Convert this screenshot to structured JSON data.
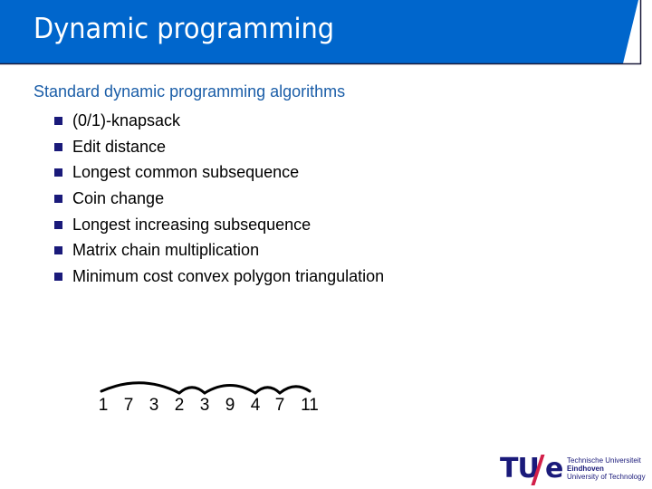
{
  "slide": {
    "title": "Dynamic programming",
    "subtitle": "Standard dynamic programming algorithms",
    "bullets": [
      "(0/1)-knapsack",
      "Edit distance",
      "Longest common subsequence",
      "Coin change",
      "Longest increasing subsequence",
      "Matrix chain multiplication",
      "Minimum cost convex polygon triangulation"
    ],
    "sequence": [
      "1",
      "7",
      "3",
      "2",
      "3",
      "9",
      "4",
      "7",
      "11"
    ],
    "sequence_arcs": [
      [
        0,
        3
      ],
      [
        3,
        4
      ],
      [
        4,
        6
      ],
      [
        6,
        7
      ],
      [
        7,
        8
      ]
    ]
  },
  "logo": {
    "tu": "TU",
    "e": "e",
    "line1": "Technische Universiteit",
    "line2": "Eindhoven",
    "line3": "University of Technology"
  },
  "colors": {
    "header_blue": "#0066cc",
    "subtitle_blue": "#1b5ea8",
    "bullet_navy": "#1a1a7a",
    "logo_red": "#d21f49"
  }
}
